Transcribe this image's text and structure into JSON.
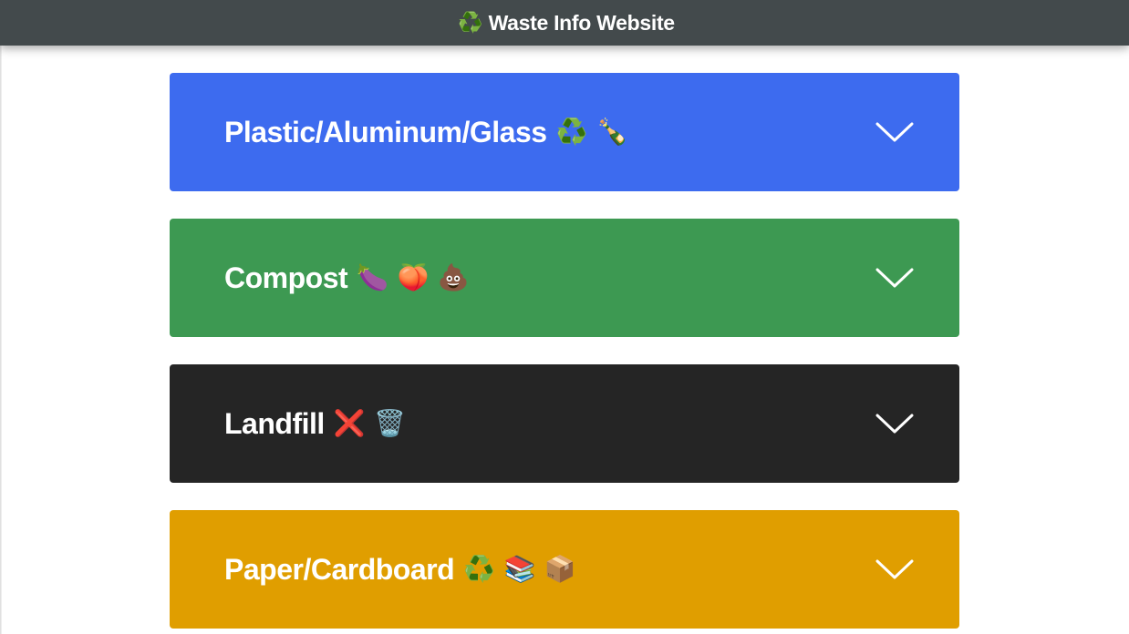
{
  "header": {
    "icon": "♻️",
    "title": "Waste Info Website",
    "background": "#434a4c"
  },
  "categories": [
    {
      "label": "Plastic/Aluminum/Glass",
      "emojis": [
        "♻️",
        "🍾"
      ],
      "color": "#3d6bef",
      "icon": "chevron-down-icon"
    },
    {
      "label": "Compost",
      "emojis": [
        "🍆",
        "🍑",
        "💩"
      ],
      "color": "#3d9952",
      "icon": "chevron-down-icon"
    },
    {
      "label": "Landfill",
      "emojis": [
        "❌",
        "🗑️"
      ],
      "color": "#252525",
      "icon": "chevron-down-icon"
    },
    {
      "label": "Paper/Cardboard",
      "emojis": [
        "♻️",
        "📚",
        "📦"
      ],
      "color": "#e09e00",
      "icon": "chevron-down-icon"
    }
  ]
}
